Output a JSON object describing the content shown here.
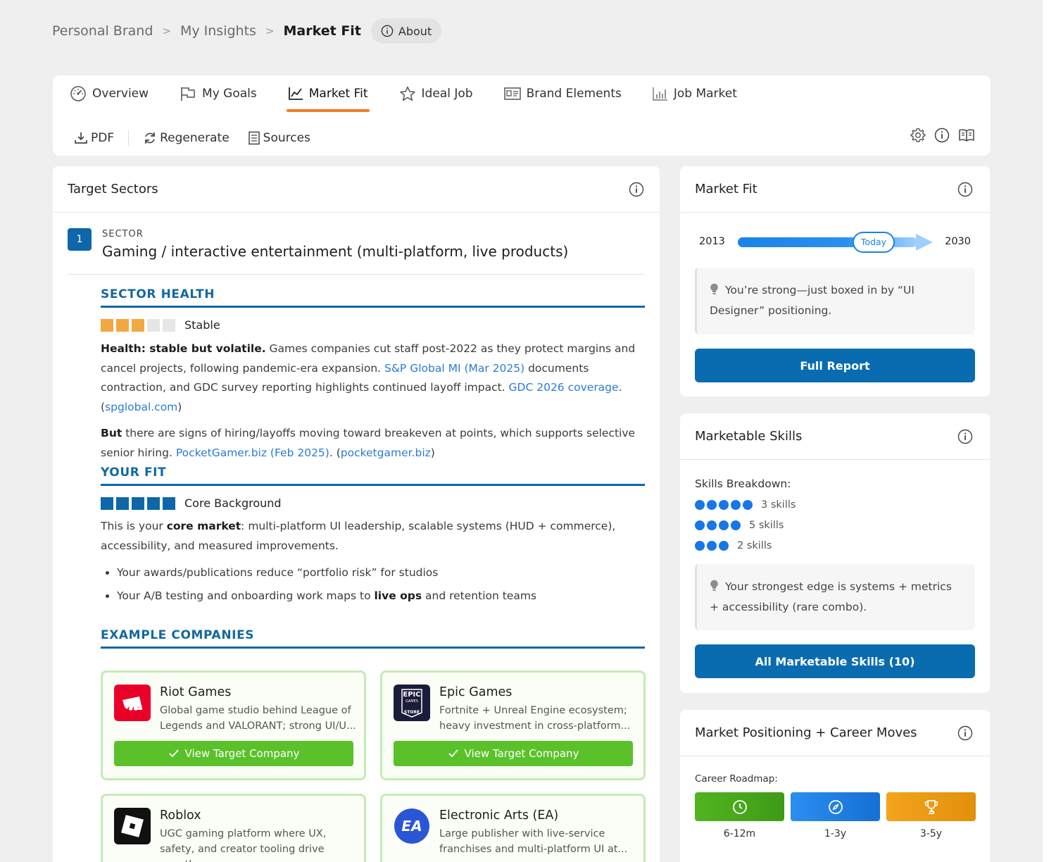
{
  "breadcrumb": {
    "item1": "Personal Brand",
    "item2": "My Insights",
    "current": "Market Fit",
    "separator": ">",
    "about_label": "About"
  },
  "tabs": [
    {
      "label": "Overview",
      "icon": "gauge-icon"
    },
    {
      "label": "My Goals",
      "icon": "flag-icon"
    },
    {
      "label": "Market Fit",
      "icon": "line-chart-icon",
      "active": true
    },
    {
      "label": "Ideal Job",
      "icon": "star-icon"
    },
    {
      "label": "Brand Elements",
      "icon": "id-card-icon"
    },
    {
      "label": "Job Market",
      "icon": "bar-chart-icon"
    }
  ],
  "toolbar": {
    "pdf_label": "PDF",
    "regenerate_label": "Regenerate",
    "sources_label": "Sources"
  },
  "target_sectors": {
    "title": "Target Sectors",
    "sector_number": "1",
    "sector_label": "SECTOR",
    "sector_title": "Gaming / interactive entertainment (multi-platform, live products)",
    "health": {
      "heading": "SECTOR HEALTH",
      "rating": 3,
      "max": 5,
      "rating_label": "Stable",
      "p1_bold": "Health: stable but volatile.",
      "p1_text1": " Games companies cut staff post-2022 as they protect margins and cancel projects, following pandemic-era expansion. ",
      "p1_link1": "S&P Global MI (Mar 2025)",
      "p1_text2": " documents contraction, and GDC survey reporting highlights continued layoff impact. ",
      "p1_link2": "GDC 2026 coverage",
      "p1_text3": ". (",
      "p1_link3": "spglobal.com",
      "p1_text4": ")",
      "p2_bold": "But",
      "p2_text1": " there are signs of hiring/layoffs moving toward breakeven at points, which supports selective senior hiring. ",
      "p2_link1": "PocketGamer.biz (Feb 2025)",
      "p2_text2": ". (",
      "p2_link2": "pocketgamer.biz",
      "p2_text3": ")"
    },
    "fit": {
      "heading": "YOUR FIT",
      "rating": 5,
      "max": 5,
      "rating_label": "Core Background",
      "p_text1": "This is your ",
      "p_bold": "core market",
      "p_text2": ": multi-platform UI leadership, scalable systems (HUD + commerce), accessibility, and measured improvements.",
      "bullet1": "Your awards/publications reduce “portfolio risk” for studios",
      "bullet2_text1": "Your A/B testing and onboarding work maps to ",
      "bullet2_bold": "live ops",
      "bullet2_text2": " and retention teams"
    },
    "companies_heading": "EXAMPLE COMPANIES",
    "view_button_label": "View Target Company",
    "companies": [
      {
        "name": "Riot Games",
        "desc": "Global game studio behind League of Legends and VALORANT; strong UI/U...",
        "logo_color": "#eb0029"
      },
      {
        "name": "Epic Games",
        "desc": "Fortnite + Unreal Engine ecosystem; heavy investment in cross-platform...",
        "logo_color": "#1b1b3a",
        "logo_text_top": "EPIC",
        "logo_text_mid": "GAMES",
        "logo_text_bottom": "STORE"
      },
      {
        "name": "Roblox",
        "desc": "UGC gaming platform where UX, safety, and creator tooling drive growth.",
        "logo_color": "#111111"
      },
      {
        "name": "Electronic Arts (EA)",
        "desc": "Large publisher with live-service franchises and multi-platform UI at...",
        "logo_color": "#2a56d6",
        "logo_text": "EA"
      }
    ]
  },
  "market_fit": {
    "title": "Market Fit",
    "start_year": "2013",
    "end_year": "2030",
    "today_label": "Today",
    "insight": "You’re strong—just boxed in by “UI Designer” positioning.",
    "button_label": "Full Report"
  },
  "marketable_skills": {
    "title": "Marketable Skills",
    "breakdown_label": "Skills Breakdown:",
    "rows": [
      {
        "dots": 5,
        "label": "3 skills"
      },
      {
        "dots": 4,
        "label": "5 skills"
      },
      {
        "dots": 3,
        "label": "2 skills"
      }
    ],
    "insight": "Your strongest edge is systems + metrics + accessibility (rare combo).",
    "button_label": "All Marketable Skills (10)"
  },
  "positioning": {
    "title": "Market Positioning + Career Moves",
    "roadmap_label": "Career Roadmap:",
    "stages": [
      {
        "label": "6-12m",
        "icon": "clock-icon",
        "color": "#49a620"
      },
      {
        "label": "1-3y",
        "icon": "compass-icon",
        "color": "#1a82e8"
      },
      {
        "label": "3-5y",
        "icon": "trophy-icon",
        "color": "#ee9c15"
      }
    ]
  },
  "colors": {
    "accent_orange": "#f47b20",
    "primary_blue": "#0a6cb0",
    "section_blue": "#13689e",
    "health_meter": "#f1a840",
    "fit_meter": "#0e67a8",
    "company_button": "#5bc12a",
    "link": "#2b7bd6"
  }
}
